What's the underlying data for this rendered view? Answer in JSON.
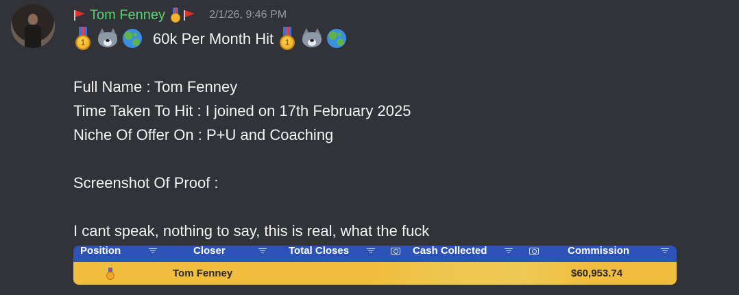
{
  "message": {
    "author": "Tom Fenney",
    "timestamp": "2/1/26, 9:46 PM",
    "title": "60k Per Month Hit",
    "lines": [
      "Full Name : Tom Fenney",
      "Time Taken To Hit : I joined on 17th February 2025",
      "Niche Of Offer On : P+U and Coaching",
      "Screenshot Of Proof :",
      "I cant speak, nothing to say, this is real, what the fuck"
    ]
  },
  "table": {
    "headers": {
      "position": "Position",
      "closer": "Closer",
      "total_closes": "Total Closes",
      "cash_collected": "Cash Collected",
      "commission": "Commission"
    },
    "row": {
      "closer": "Tom Fenney",
      "commission": "$60,953.74"
    }
  },
  "colors": {
    "username": "#5bd170",
    "timestamp": "#949ba4",
    "table_header": "#2e53b8",
    "table_row": "#f1bd3f",
    "background": "#313338"
  },
  "icons": {
    "header_left": "red-flag-icon",
    "header_medal": "first-place-medal-icon",
    "header_right": "red-flag-icon",
    "title_emoji": [
      "first-place-medal-icon",
      "wolf-icon",
      "globe-icon"
    ]
  }
}
